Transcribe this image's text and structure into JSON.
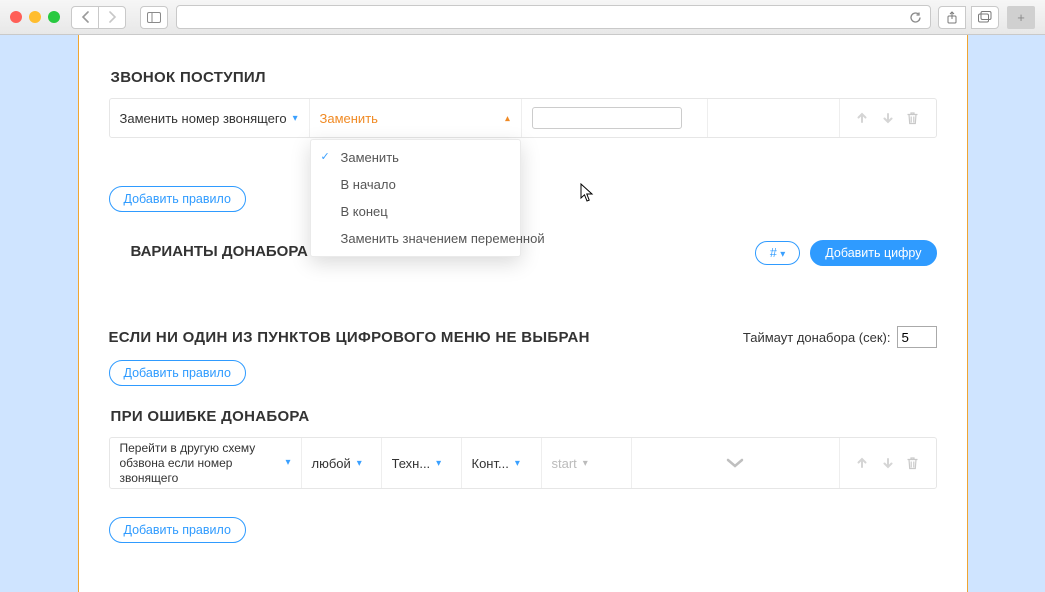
{
  "chrome": {
    "reload_title": "Reload",
    "share_title": "Share",
    "tabs_title": "Tabs"
  },
  "section_incoming": {
    "title": "ЗВОНОК ПОСТУПИЛ"
  },
  "rule1": {
    "field": "Заменить номер звонящего",
    "op_selected": "Заменить",
    "op_options": [
      "Заменить",
      "В начало",
      "В конец",
      "Заменить значением переменной"
    ],
    "value": ""
  },
  "buttons": {
    "add_rule": "Добавить правило",
    "add_digit": "Добавить цифру",
    "hash": "#"
  },
  "section_variants": {
    "title": "ВАРИАНТЫ ДОНАБОРА"
  },
  "section_none": {
    "title": "ЕСЛИ НИ ОДИН ИЗ ПУНКТОВ ЦИФРОВОГО МЕНЮ НЕ ВЫБРАН",
    "timeout_label": "Таймаут донабора (сек):",
    "timeout_value": "5"
  },
  "section_err": {
    "title": "ПРИ ОШИБКЕ ДОНАБОРА"
  },
  "rule_err": {
    "action": "Перейти в другую схему обзвона если номер звонящего",
    "cond": "любой",
    "p1": "Техн...",
    "p2": "Конт...",
    "p3": "start"
  }
}
